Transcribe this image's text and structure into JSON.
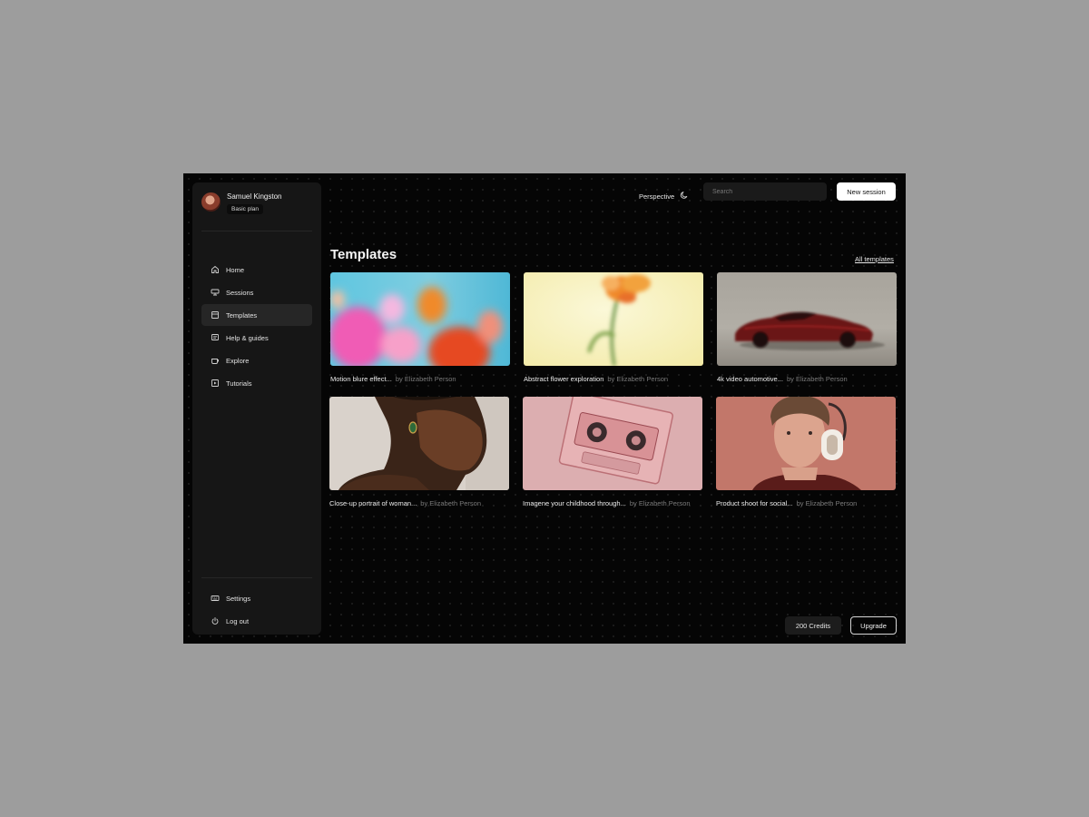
{
  "user": {
    "name": "Samuel Kingston",
    "plan": "Basic plan"
  },
  "nav": {
    "items": [
      {
        "label": "Home",
        "icon": "home-icon"
      },
      {
        "label": "Sessions",
        "icon": "sessions-icon"
      },
      {
        "label": "Templates",
        "icon": "templates-icon",
        "active": true
      },
      {
        "label": "Help & guides",
        "icon": "help-icon"
      },
      {
        "label": "Explore",
        "icon": "explore-icon"
      },
      {
        "label": "Tutorials",
        "icon": "tutorials-icon"
      }
    ],
    "bottom": [
      {
        "label": "Settings",
        "icon": "settings-icon"
      },
      {
        "label": "Log out",
        "icon": "power-icon"
      }
    ]
  },
  "header": {
    "perspective_label": "Perspective",
    "search_placeholder": "Search",
    "new_session_label": "New session"
  },
  "main": {
    "title": "Templates",
    "all_templates_label": "All templates",
    "templates": [
      {
        "title": "Motion blure effect...",
        "author": "by Elizabeth Person"
      },
      {
        "title": "Abstract flower exploration",
        "author": "by Elizabeth Person"
      },
      {
        "title": "4k video automotive...",
        "author": "by Elizabeth Person"
      },
      {
        "title": "Close-up portrait of woman...",
        "author": "by Elizabeth Person"
      },
      {
        "title": "Imagene your childhood through...",
        "author": "by Elizabeth Person"
      },
      {
        "title": "Product shoot for social...",
        "author": "by Elizabeth Person"
      }
    ]
  },
  "footer": {
    "credits_label": "200 Credits",
    "upgrade_label": "Upgrade"
  },
  "colors": {
    "background": "#050505",
    "sidebar": "#161616",
    "accent": "#ffffff",
    "muted_text": "#7a7a7a"
  }
}
